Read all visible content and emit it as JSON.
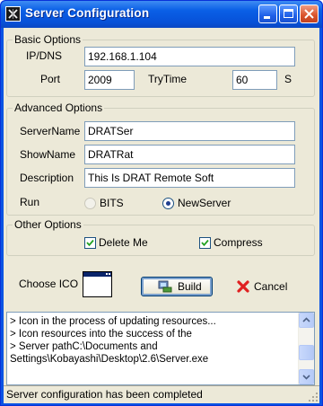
{
  "window": {
    "title": "Server Configuration"
  },
  "titlebar_buttons": [
    "minimize",
    "maximize",
    "close"
  ],
  "basic": {
    "legend": "Basic Options",
    "ip_label": "IP/DNS",
    "ip_value": "192.168.1.104",
    "port_label": "Port",
    "port_value": "2009",
    "trytime_label": "TryTime",
    "trytime_value": "60",
    "trytime_unit": "S"
  },
  "advanced": {
    "legend": "Advanced Options",
    "servername_label": "ServerName",
    "servername_value": "DRATSer",
    "showname_label": "ShowName",
    "showname_value": "DRATRat",
    "description_label": "Description",
    "description_value": "This Is DRAT Remote Soft",
    "run_label": "Run",
    "run_options": [
      {
        "label": "BITS",
        "selected": false,
        "enabled": false
      },
      {
        "label": "NewServer",
        "selected": true,
        "enabled": true
      }
    ]
  },
  "other": {
    "legend": "Other Options",
    "delete_me_label": "Delete Me",
    "delete_me_checked": true,
    "compress_label": "Compress",
    "compress_checked": true
  },
  "actions": {
    "choose_ico_label": "Choose ICO",
    "build_label": "Build",
    "cancel_label": "Cancel"
  },
  "log": {
    "lines": [
      "> Icon in the process of updating resources...",
      "> Icon resources into the success of the",
      "> Server pathC:\\Documents and",
      "Settings\\Kobayashi\\Desktop\\2.6\\Server.exe"
    ]
  },
  "status": {
    "text": "Server configuration has been completed"
  },
  "colors": {
    "titlebar": "#0a54e3",
    "dialog_bg": "#ece9d8",
    "input_border": "#7f9db9",
    "cancel_icon": "#e02020",
    "check": "#21a121"
  },
  "icons": [
    "app-icon",
    "minimize-icon",
    "maximize-icon",
    "close-icon",
    "build-icon",
    "cancel-icon",
    "window-ico-preview",
    "size-grip-icon"
  ]
}
